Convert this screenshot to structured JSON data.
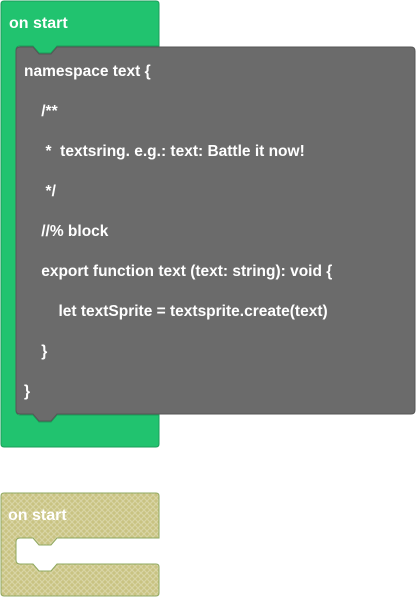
{
  "blocks": {
    "on_start_active": {
      "label": "on start",
      "color": "#21c36f",
      "border": "#1a9e59"
    },
    "code_block": {
      "color": "#6b6b6b",
      "border": "#565656",
      "lines": [
        "namespace text {",
        "    /**",
        "     *  textsring. e.g.: text: Battle it now!",
        "     */",
        "    //% block",
        "    export function text (text: string): void {",
        "        let textSprite = textsprite.create(text)",
        "    }",
        "}"
      ]
    },
    "on_start_disabled": {
      "label": "on start",
      "color": "#c8c17e",
      "border": "#8fa860"
    }
  }
}
